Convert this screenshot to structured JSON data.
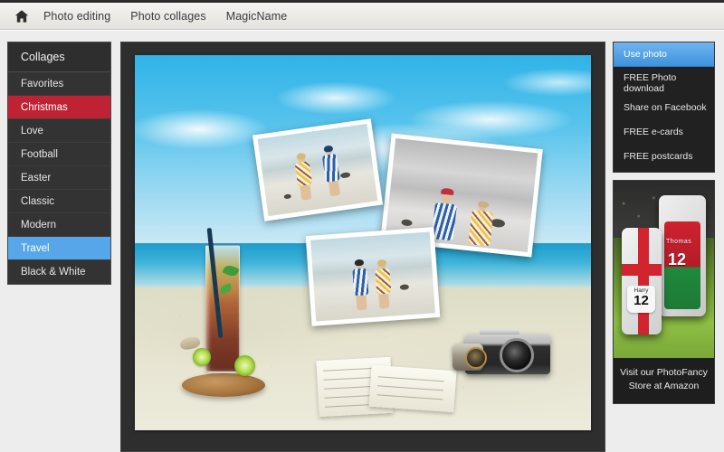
{
  "header": {
    "home_icon": "home-icon",
    "nav": [
      {
        "label": "Photo editing"
      },
      {
        "label": "Photo collages"
      },
      {
        "label": "MagicName"
      }
    ]
  },
  "sidebar": {
    "title": "Collages",
    "items": [
      {
        "label": "Favorites",
        "state": "normal"
      },
      {
        "label": "Christmas",
        "state": "red"
      },
      {
        "label": "Love",
        "state": "normal"
      },
      {
        "label": "Football",
        "state": "normal"
      },
      {
        "label": "Easter",
        "state": "normal"
      },
      {
        "label": "Classic",
        "state": "normal"
      },
      {
        "label": "Modern",
        "state": "normal"
      },
      {
        "label": "Travel",
        "state": "blue"
      },
      {
        "label": "Black & White",
        "state": "normal"
      }
    ]
  },
  "stage": {
    "preview_alt": "Travel collage preview: beach scene with cocktail, vintage camera, postcards and three photo prints"
  },
  "rail": {
    "menu": [
      {
        "label": "Use photo",
        "active": true
      },
      {
        "label": "FREE Photo download",
        "active": false
      },
      {
        "label": "Share on Facebook",
        "active": false
      },
      {
        "label": "FREE e-cards",
        "active": false
      },
      {
        "label": "FREE postcards",
        "active": false
      }
    ],
    "ad": {
      "caption_line1": "Visit our PhotoFancy",
      "caption_line2": "Store at Amazon",
      "case_left_name": "Harry",
      "case_left_number": "12",
      "case_right_name": "Thomas",
      "case_right_number": "12"
    }
  },
  "colors": {
    "accent_blue": "#58a6ea",
    "accent_red": "#bf2233",
    "sidebar_bg": "#333333",
    "rail_bg": "#212121",
    "stage_bg": "#2e2e2e",
    "page_bg": "#ededed",
    "header_bg": "#eceae7"
  }
}
